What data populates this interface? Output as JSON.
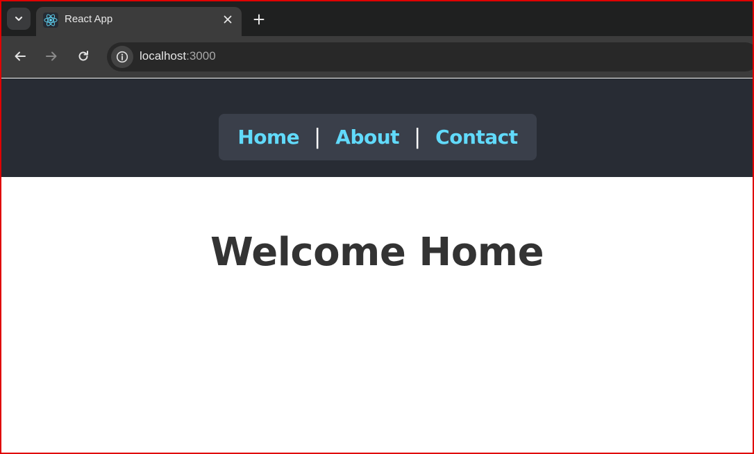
{
  "browser": {
    "tab": {
      "title": "React App"
    },
    "address_bar": {
      "host": "localhost",
      "port": ":3000"
    }
  },
  "nav": {
    "links": [
      "Home",
      "About",
      "Contact"
    ],
    "separator": "|"
  },
  "main": {
    "title": "Welcome Home"
  },
  "colors": {
    "header_bg": "#282c34",
    "navbar_bg": "#3a3f4a",
    "link": "#61dafb",
    "title": "#333333"
  },
  "icons": [
    "tab-search-icon",
    "react-favicon-icon",
    "close-icon",
    "plus-icon",
    "back-arrow-icon",
    "forward-arrow-icon",
    "reload-icon",
    "info-icon"
  ]
}
